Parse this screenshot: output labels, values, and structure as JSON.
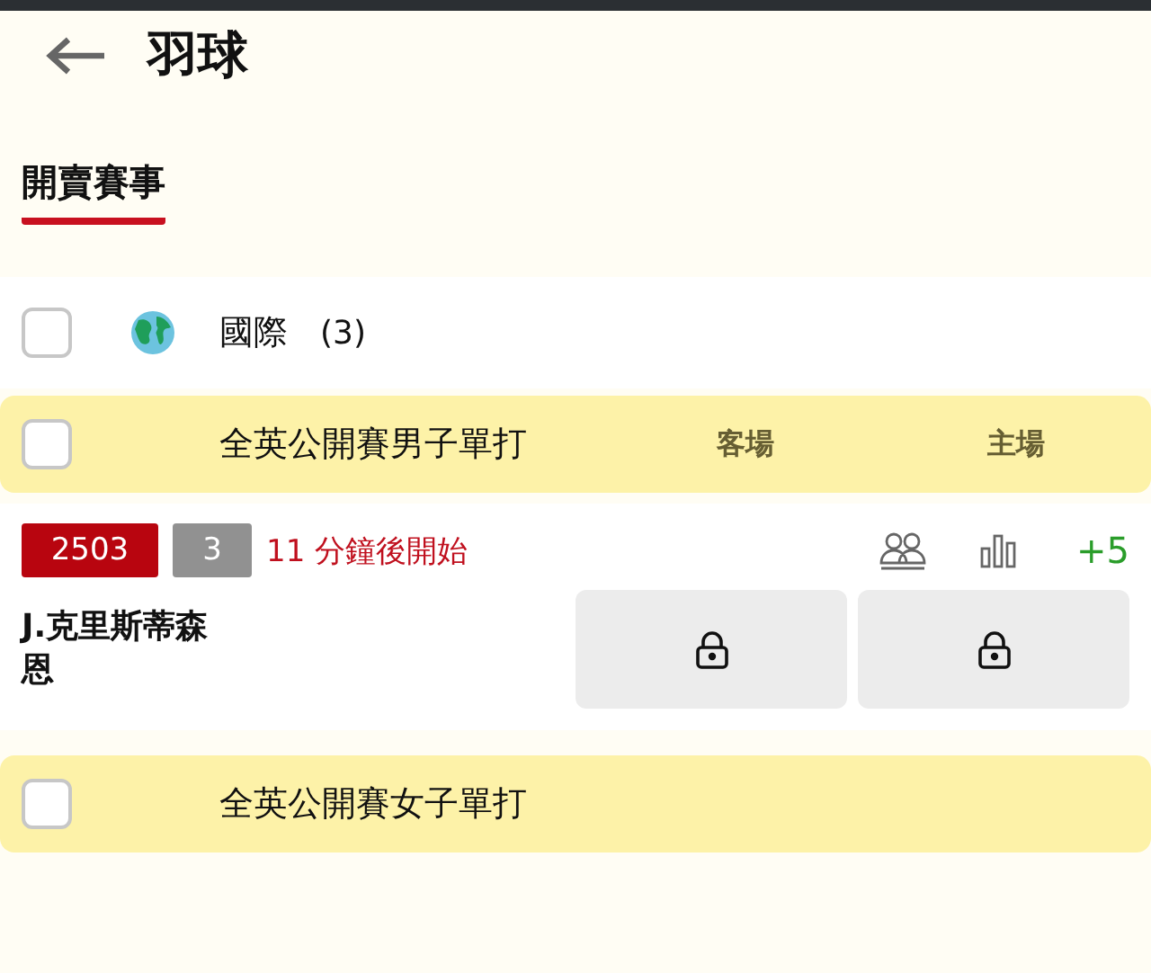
{
  "header": {
    "title": "羽球"
  },
  "tabs": [
    {
      "label": "開賣賽事",
      "selected": true
    }
  ],
  "region": {
    "name": "國際",
    "count": "(3)",
    "checked": false
  },
  "leagues": [
    {
      "name": "全英公開賽男子單打",
      "checked": false,
      "columns": [
        "客場",
        "主場"
      ],
      "matches": [
        {
          "code": "2503",
          "number": "3",
          "status": "11 分鐘後開始",
          "more": "+5",
          "player": "J.克里斯蒂森恩",
          "odds": [
            {
              "locked": true
            },
            {
              "locked": true
            }
          ]
        }
      ]
    },
    {
      "name": "全英公開賽女子單打",
      "checked": false
    }
  ]
}
